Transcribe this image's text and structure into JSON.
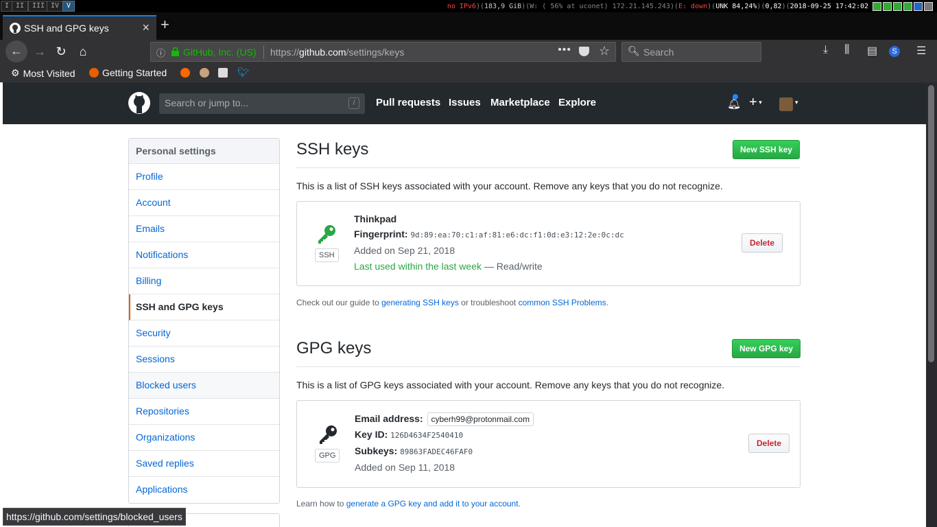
{
  "wm": {
    "workspaces": [
      "I",
      "II",
      "III",
      "IV",
      "V"
    ],
    "status": {
      "ipv6": "no IPv6",
      "disk": "183,9 GiB",
      "wifi": "W: ( 56% at uconet) 172.21.145.243",
      "eth": "E: down",
      "battery": "UNK 84,24%",
      "load": "0,82",
      "datetime": "2018-09-25 17:42:02"
    }
  },
  "browser": {
    "tab_title": "SSH and GPG keys",
    "url_org": "GitHub, Inc. (US)",
    "url_prefix": "https://",
    "url_host": "github.com",
    "url_path": "/settings/keys",
    "search_placeholder": "Search",
    "bookmarks": [
      "Most Visited",
      "Getting Started"
    ],
    "status_tip": "https://github.com/settings/blocked_users"
  },
  "github": {
    "search_placeholder": "Search or jump to...",
    "search_key": "/",
    "nav": [
      "Pull requests",
      "Issues",
      "Marketplace",
      "Explore"
    ]
  },
  "sidebar": {
    "header": "Personal settings",
    "items": [
      {
        "label": "Profile"
      },
      {
        "label": "Account"
      },
      {
        "label": "Emails"
      },
      {
        "label": "Notifications"
      },
      {
        "label": "Billing"
      },
      {
        "label": "SSH and GPG keys"
      },
      {
        "label": "Security"
      },
      {
        "label": "Sessions"
      },
      {
        "label": "Blocked users"
      },
      {
        "label": "Repositories"
      },
      {
        "label": "Organizations"
      },
      {
        "label": "Saved replies"
      },
      {
        "label": "Applications"
      }
    ],
    "selected_index": 5,
    "hover_index": 8
  },
  "ssh": {
    "title": "SSH keys",
    "new_button": "New SSH key",
    "description": "This is a list of SSH keys associated with your account. Remove any keys that you do not recognize.",
    "key": {
      "tag": "SSH",
      "name": "Thinkpad",
      "fingerprint_label": "Fingerprint:",
      "fingerprint": "9d:89:ea:70:c1:af:81:e6:dc:f1:0d:e3:12:2e:0c:dc",
      "added": "Added on Sep 21, 2018",
      "last_used": "Last used within the last week",
      "access": "— Read/write",
      "delete": "Delete"
    },
    "guide_pre": "Check out our guide to",
    "guide_link1": "generating SSH keys",
    "guide_mid": "or troubleshoot",
    "guide_link2": "common SSH Problems",
    "guide_end": "."
  },
  "gpg": {
    "title": "GPG keys",
    "new_button": "New GPG key",
    "description": "This is a list of GPG keys associated with your account. Remove any keys that you do not recognize.",
    "key": {
      "tag": "GPG",
      "email_label": "Email address:",
      "email": "cyberh99@protonmail.com",
      "keyid_label": "Key ID:",
      "keyid": "126D4634F2540410",
      "subkeys_label": "Subkeys:",
      "subkeys": "89863FADEC46FAF0",
      "added": "Added on Sep 11, 2018",
      "delete": "Delete"
    },
    "guide_pre": "Learn how to",
    "guide_link": "generate a GPG key and add it to your account",
    "guide_end": "."
  },
  "colors": {
    "github_header": "#24292e",
    "link": "#0366d6",
    "green": "#28a745",
    "danger": "#cb2431",
    "selected_accent": "#e36209"
  }
}
